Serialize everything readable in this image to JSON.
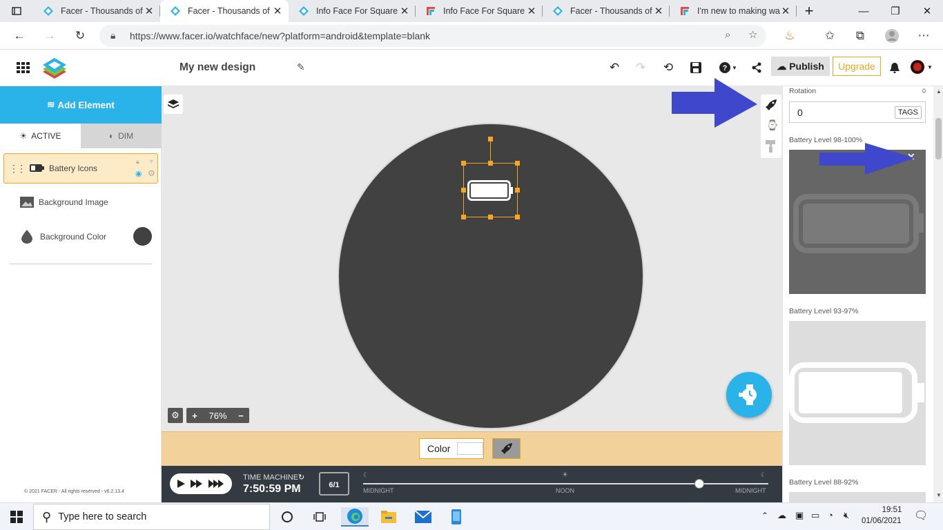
{
  "browser": {
    "tabs": [
      {
        "title": "Facer - Thousands of F",
        "favicon": "facer-icon",
        "active": false
      },
      {
        "title": "Facer - Thousands of F",
        "favicon": "facer-icon",
        "active": true
      },
      {
        "title": "Info Face For Square W",
        "favicon": "facer-icon",
        "active": false
      },
      {
        "title": "Info Face For Square W",
        "favicon": "forum-icon",
        "active": false
      },
      {
        "title": "Facer - Thousands of F",
        "favicon": "facer-icon",
        "active": false
      },
      {
        "title": "I'm new to making wa",
        "favicon": "forum-icon",
        "active": false
      }
    ],
    "new_tab": "+",
    "url": "https://www.facer.io/watchface/new?platform=android&template=blank"
  },
  "header": {
    "design_name": "My new design",
    "publish_label": "Publish",
    "upgrade_label": "Upgrade"
  },
  "left": {
    "add_element": "Add Element",
    "tab_active": "ACTIVE",
    "tab_dim": "DIM",
    "layers": [
      {
        "label": "Battery Icons",
        "selected": true
      },
      {
        "label": "Background Image",
        "selected": false
      },
      {
        "label": "Background Color",
        "selected": false
      }
    ],
    "background_color": "#414141",
    "copyright": "© 2021 FACER - All rights reserved - v6.2.13.4"
  },
  "canvas": {
    "zoom": "76%",
    "face_color": "#414141"
  },
  "colorbar": {
    "color_label": "Color"
  },
  "timemachine": {
    "label": "TIME MACHINE",
    "time": "7:50:59 PM",
    "date": "6/1",
    "marks": [
      "MIDNIGHT",
      "NOON",
      "MIDNIGHT"
    ],
    "position_fraction": 0.83
  },
  "right": {
    "rotation_label": "Rotation",
    "rotation_small_value": "0",
    "rotation_value": "0",
    "tags_label": "TAGS",
    "levels": [
      {
        "label": "Battery Level 98-100%",
        "fill": 1.0
      },
      {
        "label": "Battery Level 93-97%",
        "fill": 0.95
      },
      {
        "label": "Battery Level 88-92%",
        "fill": 0.9
      }
    ]
  },
  "taskbar": {
    "search_placeholder": "Type here to search",
    "time": "19:51",
    "date": "01/06/2021"
  },
  "colors": {
    "accent": "#29b3e8",
    "selection": "#f5a623",
    "annotation_arrow": "#3f48cc",
    "publish_bg": "#e0e0e0",
    "upgrade": "#e8a81f"
  }
}
